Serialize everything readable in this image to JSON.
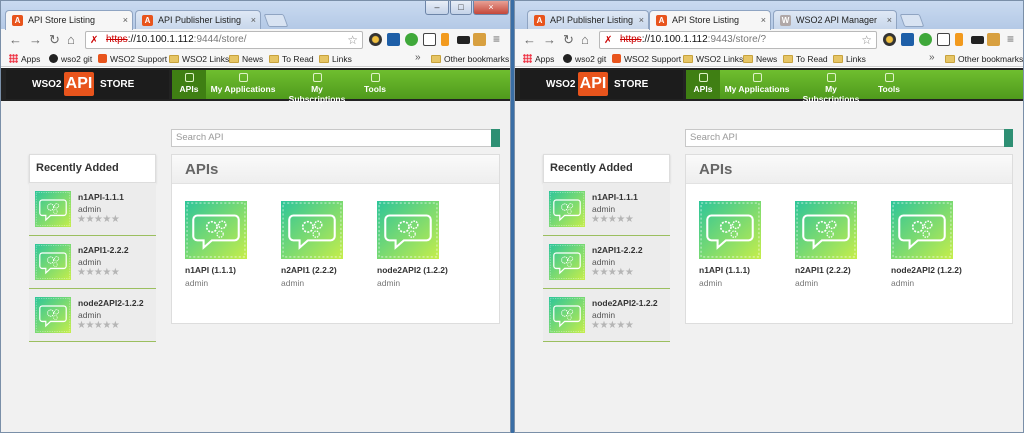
{
  "windows": [
    {
      "tabs": [
        {
          "label": "API Store Listing",
          "active": true
        },
        {
          "label": "API Publisher Listing",
          "active": false
        }
      ],
      "url": {
        "scheme": "https",
        "host": "://10.100.1.112",
        "path": ":9444/store/"
      },
      "bookmarks": [
        "Apps",
        "wso2 git",
        "WSO2 Support",
        "WSO2 Links",
        "News",
        "To Read",
        "Links",
        "»",
        "Other bookmarks"
      ],
      "store": {
        "logo": {
          "left": "WSO2",
          "api": "API",
          "right": "STORE"
        },
        "nav": [
          "APIs",
          "My Applications",
          "My Subscriptions",
          "Tools"
        ],
        "search_placeholder": "Search API",
        "recent_title": "Recently Added",
        "recent": [
          {
            "name": "n1API-1.1.1",
            "owner": "admin",
            "rating": 0
          },
          {
            "name": "n2API1-2.2.2",
            "owner": "admin",
            "rating": 0
          },
          {
            "name": "node2API2-1.2.2",
            "owner": "admin",
            "rating": 0
          }
        ],
        "apis_title": "APIs",
        "apis": [
          {
            "name": "n1API (1.1.1)",
            "owner": "admin"
          },
          {
            "name": "n2API1 (2.2.2)",
            "owner": "admin"
          },
          {
            "name": "node2API2 (1.2.2)",
            "owner": "admin"
          }
        ]
      }
    },
    {
      "tabs": [
        {
          "label": "API Publisher Listing",
          "active": false
        },
        {
          "label": "API Store Listing",
          "active": true
        },
        {
          "label": "WSO2 API Manager",
          "active": false
        }
      ],
      "url": {
        "scheme": "https",
        "host": "://10.100.1.112",
        "path": ":9443/store/?"
      },
      "bookmarks": [
        "Apps",
        "wso2 git",
        "WSO2 Support",
        "WSO2 Links",
        "News",
        "To Read",
        "Links",
        "»",
        "Other bookmarks"
      ],
      "store": {
        "logo": {
          "left": "WSO2",
          "api": "API",
          "right": "STORE"
        },
        "nav": [
          "APIs",
          "My Applications",
          "My Subscriptions",
          "Tools"
        ],
        "search_placeholder": "Search API",
        "recent_title": "Recently Added",
        "recent": [
          {
            "name": "n1API-1.1.1",
            "owner": "admin",
            "rating": 0
          },
          {
            "name": "n2API1-2.2.2",
            "owner": "admin",
            "rating": 0
          },
          {
            "name": "node2API2-1.2.2",
            "owner": "admin",
            "rating": 0
          }
        ],
        "apis_title": "APIs",
        "apis": [
          {
            "name": "n1API (1.1.1)",
            "owner": "admin"
          },
          {
            "name": "n2API1 (2.2.2)",
            "owner": "admin"
          },
          {
            "name": "node2API2 (1.2.2)",
            "owner": "admin"
          }
        ]
      }
    }
  ],
  "icons": {
    "back": "arrow-left-icon",
    "forward": "arrow-right-icon",
    "reload": "reload-icon",
    "home": "home-icon",
    "bookmark_star": "star-icon",
    "tab_close": "close-icon",
    "window_minimize": "minimize-icon",
    "window_maximize": "maximize-icon",
    "window_close": "close-icon",
    "api_thumbnail": "api-gears-chat-icon",
    "rating_star": "star-icon"
  },
  "glyphs": {
    "back": "←",
    "forward": "→",
    "reload": "↻",
    "home": "⌂",
    "star": "☆",
    "close": "×",
    "min": "–",
    "max": "□",
    "rating": "★★★★★"
  },
  "colors": {
    "nav_green": "#5fae25",
    "nav_active": "#3f7f13",
    "logo_orange": "#e8541c",
    "thumb_teal": "#2cc59a",
    "thumb_lime": "#c6ee4a",
    "search_button": "#2e8f73",
    "star_grey": "#b5b5b5",
    "insecure_red": "#cc0000"
  }
}
